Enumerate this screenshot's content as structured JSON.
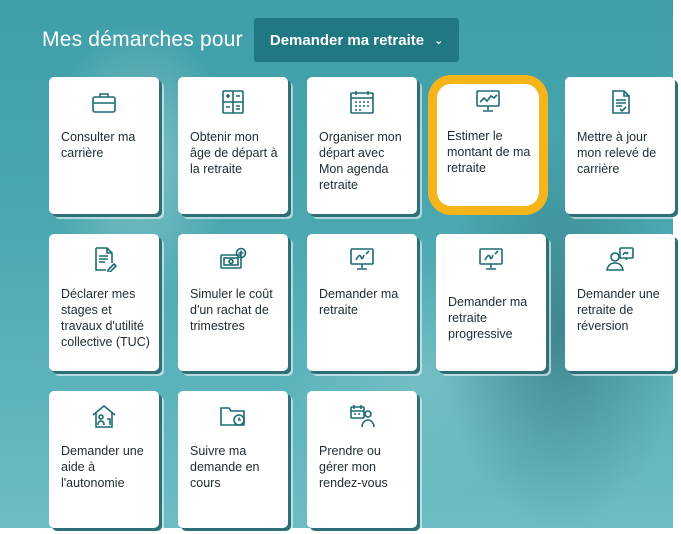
{
  "heading": {
    "prefix": "Mes démarches pour",
    "selected": "Demander ma retraite",
    "chevron_icon": "chevron-down-icon"
  },
  "highlight_color": "#f5b51a",
  "cards": [
    {
      "label": "Consulter ma carrière",
      "icon": "briefcase-icon"
    },
    {
      "label": "Obtenir mon âge de départ à la retraite",
      "icon": "calculator-icon"
    },
    {
      "label": "Organiser mon départ avec Mon agenda retraite",
      "icon": "calendar-icon"
    },
    {
      "label": "Estimer le montant de ma retraite",
      "icon": "chart-monitor-icon"
    },
    {
      "label": "Mettre à jour mon relevé de carrière",
      "icon": "document-check-icon"
    },
    {
      "label": "Déclarer mes stages et travaux d'utilité collective (TUC)",
      "icon": "document-edit-icon"
    },
    {
      "label": "Simuler le coût d'un rachat de trimestres",
      "icon": "banknote-plus-icon"
    },
    {
      "label": "Demander ma retraite",
      "icon": "monitor-sign-icon"
    },
    {
      "label": "Demander ma retraite progressive",
      "icon": "monitor-sign-icon"
    },
    {
      "label": "Demander une retraite de réversion",
      "icon": "person-monitor-icon"
    },
    {
      "label": "Demander une aide à l'autonomie",
      "icon": "house-person-icon"
    },
    {
      "label": "Suivre ma demande en cours",
      "icon": "folder-clock-icon"
    },
    {
      "label": "Prendre ou gérer mon rendez-vous",
      "icon": "calendar-person-icon"
    }
  ]
}
